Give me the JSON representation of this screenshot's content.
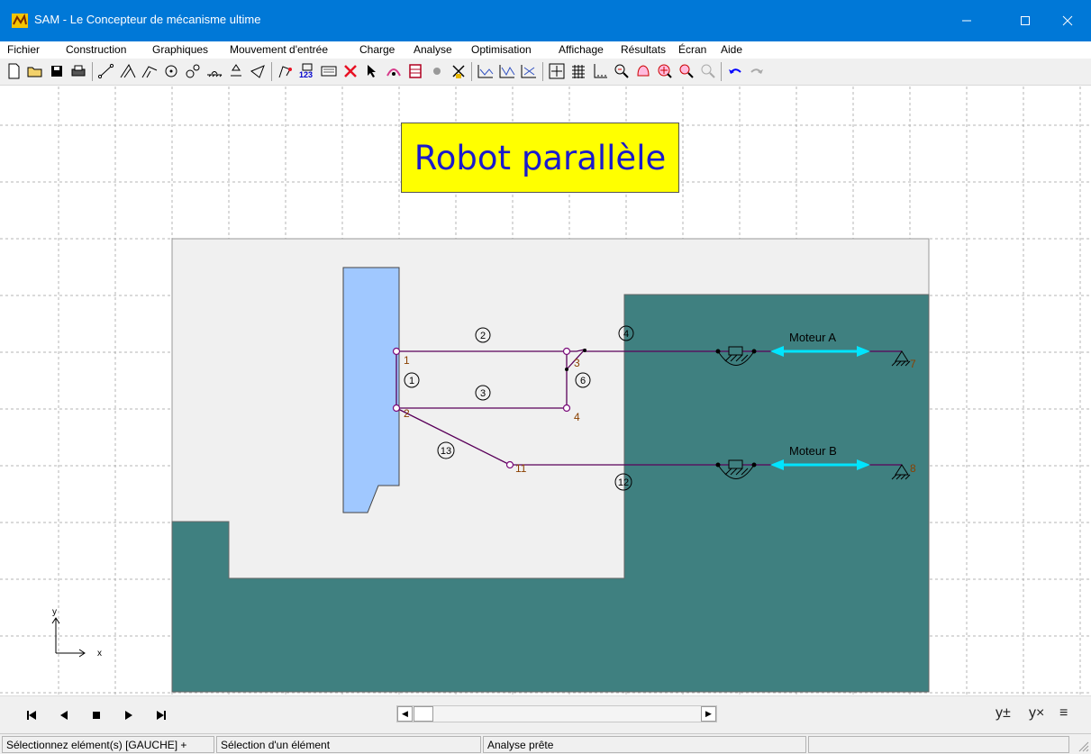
{
  "window": {
    "title": "SAM - Le Concepteur de mécanisme ultime",
    "controls": [
      "minimize",
      "maximize",
      "close"
    ]
  },
  "menu": [
    "Fichier",
    "Construction",
    "Graphiques",
    "Mouvement d'entrée",
    "Charge",
    "Analyse",
    "Optimisation",
    "Affichage",
    "Résultats",
    "Écran",
    "Aide"
  ],
  "toolbar": {
    "icons": [
      "new-file-icon",
      "open-folder-icon",
      "save-icon",
      "print-icon",
      "beam-element-icon",
      "truss-element-icon",
      "slider-element-icon",
      "gear-element-icon",
      "belt-element-icon",
      "ground-element-icon",
      "spring-element-icon",
      "damper-element-icon",
      "polyline-icon",
      "numbering-icon",
      "properties-icon",
      "delete-icon",
      "select-cursor-icon",
      "node-icon",
      "fix-node-icon",
      "unfix-icon",
      "wind-icon",
      "graph-x-icon",
      "graph-y-icon",
      "graph-xy-icon",
      "grid-icon",
      "grid-snap-icon",
      "axis-icon",
      "zoom-out-icon",
      "pan-icon",
      "zoom-fit-icon",
      "zoom-window-icon",
      "zoom-prev-icon",
      "undo-icon",
      "redo-icon"
    ],
    "colors": {
      "delete": "#e81123",
      "arrow": "#0000ff"
    }
  },
  "drawing": {
    "title": "Robot parallèle",
    "colors": {
      "background_frame": "#f0f0f0",
      "ground_area": "#3f8080",
      "end_effector": "#a0c8ff",
      "links": "#5a005a",
      "nodes": "#7a0a7a",
      "node_labels": "#8a4000",
      "motor_arrow": "#00e5ff",
      "title_bg": "#ffff00",
      "title_text": "#1a1acc"
    },
    "node_labels": [
      "1",
      "2",
      "3",
      "4",
      "7",
      "8",
      "11"
    ],
    "element_labels": [
      "1",
      "2",
      "3",
      "4",
      "6",
      "12",
      "13"
    ],
    "motor_a": "Moteur A",
    "motor_b": "Moteur B",
    "axis_x": "x",
    "axis_y": "y"
  },
  "player": {
    "buttons": [
      "first-frame-icon",
      "previous-frame-icon",
      "stop-icon",
      "next-frame-icon",
      "last-frame-icon"
    ],
    "right_tools": [
      "y±",
      "y×",
      "≡"
    ]
  },
  "status": {
    "panel1": "Sélectionnez elément(s) [GAUCHE] +",
    "panel2": "Sélection d'un élément",
    "panel3": "Analyse prête",
    "panel4": ""
  }
}
